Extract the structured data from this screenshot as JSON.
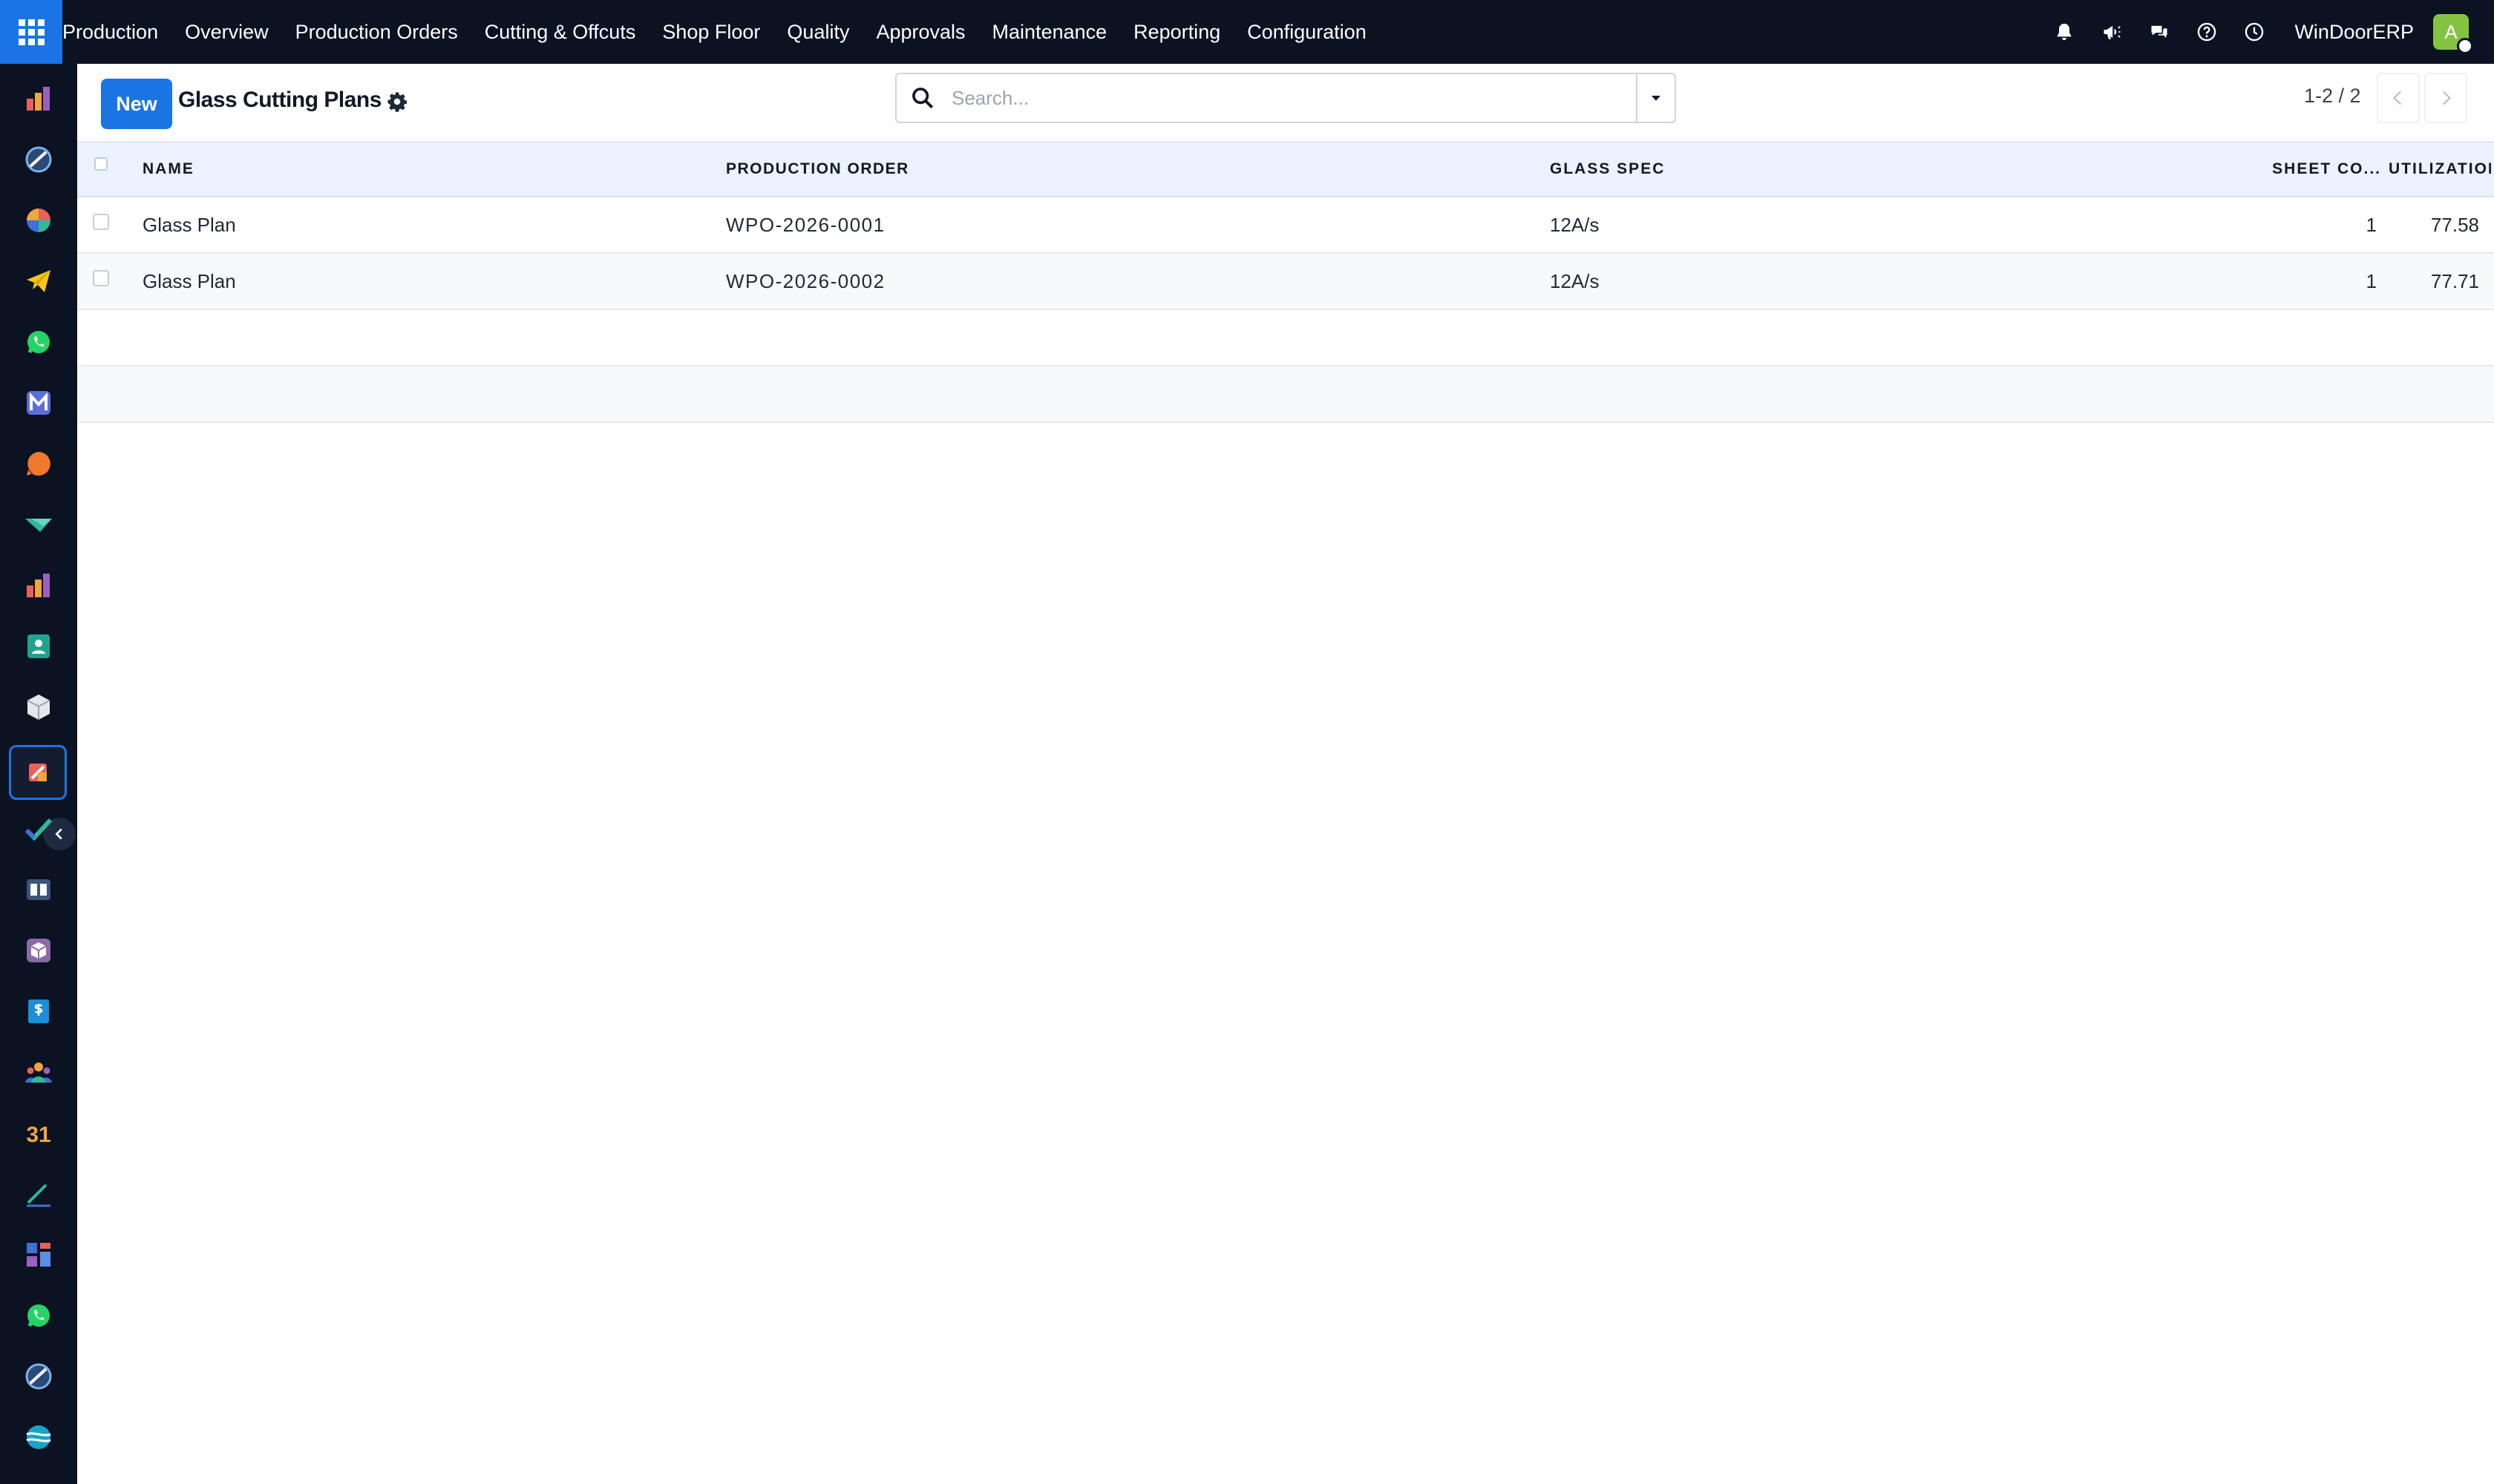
{
  "navbar": {
    "brand": "Production",
    "menu": [
      "Overview",
      "Production Orders",
      "Cutting & Offcuts",
      "Shop Floor",
      "Quality",
      "Approvals",
      "Maintenance",
      "Reporting",
      "Configuration"
    ],
    "icons": [
      "bell-icon",
      "megaphone-icon",
      "chat-icon",
      "help-icon",
      "clock-icon"
    ],
    "company": "WinDoorERP",
    "avatar_initial": "A",
    "avatar_color": "#84c341",
    "background": "#0b1222",
    "accent": "#1b74e4"
  },
  "sidebar": {
    "apps": [
      "inventory-app-icon",
      "discuss-app-icon",
      "dashboard-app-icon",
      "telegram-app-icon",
      "whatsapp-app-icon",
      "mail-app-icon",
      "livechat-app-icon",
      "marketing-app-icon",
      "sales-app-icon",
      "contacts-app-icon",
      "product-app-icon",
      "production-app-icon",
      "quality-app-icon",
      "knowledge-app-icon",
      "package-app-icon",
      "invoicing-app-icon",
      "employees-app-icon",
      "calendar-app-icon",
      "sign-app-icon",
      "board-app-icon",
      "whatsapp-app-icon",
      "discuss-app-icon",
      "website-app-icon"
    ],
    "active_index": 11,
    "calendar_label": "31"
  },
  "control": {
    "new_label": "New",
    "title": "Glass Cutting Plans",
    "search_placeholder": "Search...",
    "pager": "1-2 / 2"
  },
  "table": {
    "columns": [
      "NAME",
      "PRODUCTION ORDER",
      "GLASS SPEC",
      "SHEET CO...",
      "UTILIZATION (..."
    ],
    "rows": [
      {
        "name": "Glass Plan",
        "production_order": "WPO-2026-0001",
        "glass_spec": "12A/s",
        "sheet_count": "1",
        "utilization": "77.58"
      },
      {
        "name": "Glass Plan",
        "production_order": "WPO-2026-0002",
        "glass_spec": "12A/s",
        "sheet_count": "1",
        "utilization": "77.71"
      }
    ]
  }
}
